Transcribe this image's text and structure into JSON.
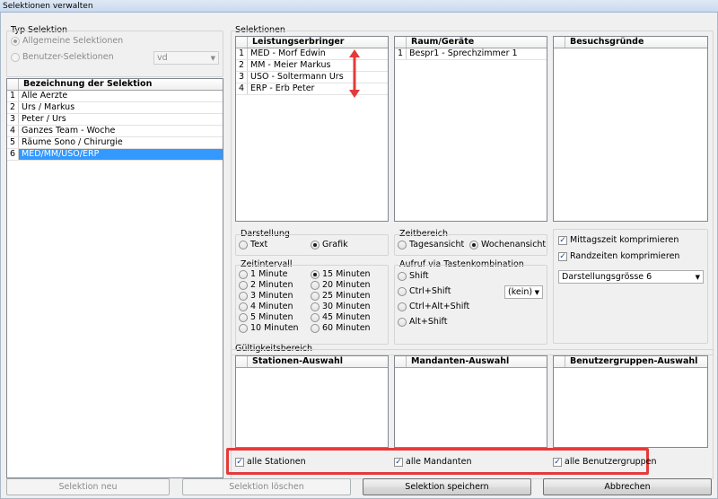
{
  "window": {
    "title": "Selektionen verwalten"
  },
  "typ_selektion": {
    "group_title": "Typ Selektion",
    "allgemeine": "Allgemeine Selektionen",
    "benutzer": "Benutzer-Selektionen",
    "user_combo": "vd"
  },
  "bezeichnung_list": {
    "header": "Bezeichnung der Selektion",
    "rows": [
      {
        "num": "1",
        "text": "Alle Aerzte"
      },
      {
        "num": "2",
        "text": "Urs / Markus"
      },
      {
        "num": "3",
        "text": "Peter / Urs"
      },
      {
        "num": "4",
        "text": "Ganzes Team - Woche"
      },
      {
        "num": "5",
        "text": "Räume Sono / Chirurgie"
      },
      {
        "num": "6",
        "text": "MED/MM/USO/ERP"
      }
    ]
  },
  "selektionen": {
    "group_title": "Selektionen",
    "leistungserbringer": {
      "header": "Leistungserbringer",
      "rows": [
        {
          "num": "1",
          "text": "MED - Morf Edwin"
        },
        {
          "num": "2",
          "text": "MM - Meier Markus"
        },
        {
          "num": "3",
          "text": "USO - Soltermann Urs"
        },
        {
          "num": "4",
          "text": "ERP - Erb Peter"
        }
      ]
    },
    "raum": {
      "header": "Raum/Geräte",
      "rows": [
        {
          "num": "1",
          "text": "Bespr1 - Sprechzimmer 1"
        }
      ]
    },
    "besuchsgruende": {
      "header": "Besuchsgründe"
    }
  },
  "darstellung": {
    "title": "Darstellung",
    "text": "Text",
    "grafik": "Grafik"
  },
  "zeitbereich": {
    "title": "Zeitbereich",
    "tages": "Tagesansicht",
    "wochen": "Wochenansicht"
  },
  "options": {
    "mittag": "Mittagszeit komprimieren",
    "rand": "Randzeiten komprimieren",
    "groesse": "Darstellungsgrösse 6"
  },
  "zeitintervall": {
    "title": "Zeitintervall",
    "left": [
      "1 Minute",
      "2 Minuten",
      "3 Minuten",
      "4 Minuten",
      "5 Minuten",
      "10 Minuten"
    ],
    "right": [
      "15 Minuten",
      "20 Minuten",
      "25 Minuten",
      "30 Minuten",
      "45 Minuten",
      "60 Minuten"
    ]
  },
  "aufruf": {
    "title": "Aufruf via Tastenkombination",
    "items": [
      "Shift",
      "Ctrl+Shift",
      "Ctrl+Alt+Shift",
      "Alt+Shift"
    ],
    "combo": "(kein)"
  },
  "gueltigkeit": {
    "group_title": "Gültigkeitsbereich",
    "stationen": "Stationen-Auswahl",
    "mandanten": "Mandanten-Auswahl",
    "benutzergruppen": "Benutzergruppen-Auswahl",
    "alle_stationen": "alle Stationen",
    "alle_mandanten": "alle Mandanten",
    "alle_benutzergruppen": "alle Benutzergruppen"
  },
  "buttons": {
    "neu": "Selektion neu",
    "loeschen": "Selektion löschen",
    "speichern": "Selektion speichern",
    "abbrechen": "Abbrechen"
  },
  "colors": {
    "selection": "#3399ff",
    "annotation": "#e53a3a"
  }
}
